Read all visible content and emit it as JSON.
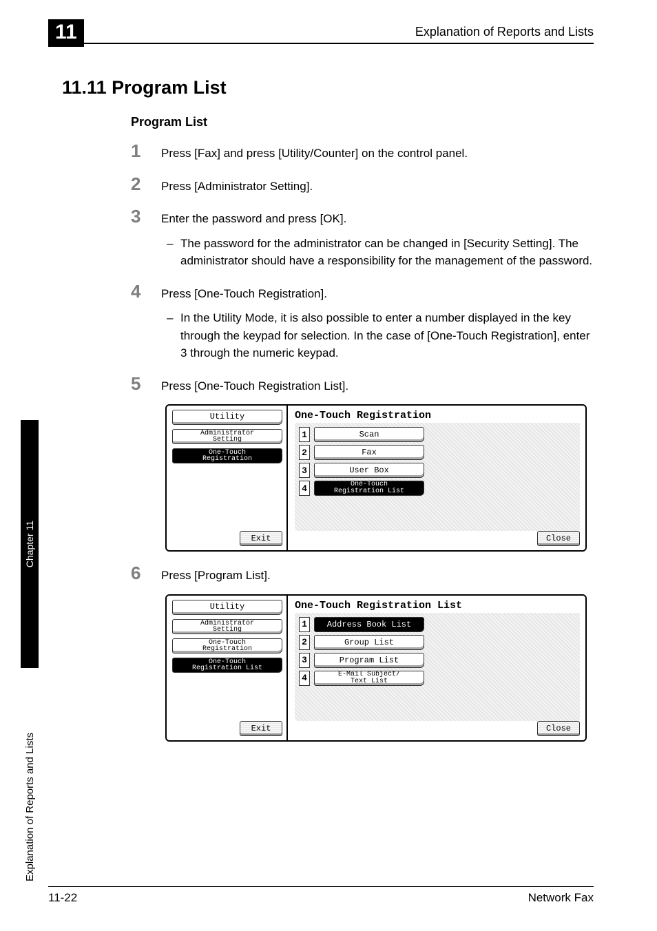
{
  "chapter_number": "11",
  "running_header": "Explanation of Reports and Lists",
  "section_title": "11.11 Program List",
  "sub_heading": "Program List",
  "steps": [
    {
      "num": "1",
      "text": "Press [Fax] and press [Utility/Counter] on the control panel."
    },
    {
      "num": "2",
      "text": "Press [Administrator Setting]."
    },
    {
      "num": "3",
      "text": "Enter the password and press [OK].",
      "subs": [
        "The password for the administrator can be changed in [Security Setting]. The administrator should have a responsibility for the management of the password."
      ]
    },
    {
      "num": "4",
      "text": "Press [One-Touch Registration].",
      "subs": [
        "In the Utility Mode, it is also possible to enter a number displayed in the key through the keypad for selection. In the case of [One-Touch Registration], enter 3 through the numeric keypad."
      ]
    },
    {
      "num": "5",
      "text": "Press [One-Touch Registration List]."
    },
    {
      "num": "6",
      "text": "Press [Program List]."
    }
  ],
  "screenshot1": {
    "left_items": [
      {
        "label": "Utility",
        "selected": false,
        "twoLine": false
      },
      {
        "label": "Administrator\nSetting",
        "selected": false,
        "twoLine": true
      },
      {
        "label": "One-Touch\nRegistration",
        "selected": true,
        "twoLine": true
      }
    ],
    "title": "One-Touch Registration",
    "rows": [
      {
        "n": "1",
        "label": "Scan",
        "selected": false
      },
      {
        "n": "2",
        "label": "Fax",
        "selected": false
      },
      {
        "n": "3",
        "label": "User Box",
        "selected": false
      },
      {
        "n": "4",
        "label": "One-Touch\nRegistration List",
        "selected": true
      }
    ],
    "exit": "Exit",
    "close": "Close"
  },
  "screenshot2": {
    "left_items": [
      {
        "label": "Utility",
        "selected": false,
        "twoLine": false
      },
      {
        "label": "Administrator\nSetting",
        "selected": false,
        "twoLine": true
      },
      {
        "label": "One-Touch\nRegistration",
        "selected": false,
        "twoLine": true
      },
      {
        "label": "One-Touch\nRegistration List",
        "selected": true,
        "twoLine": true
      }
    ],
    "title": "One-Touch Registration List",
    "rows": [
      {
        "n": "1",
        "label": "Address Book List",
        "selected": true
      },
      {
        "n": "2",
        "label": "Group List",
        "selected": false
      },
      {
        "n": "3",
        "label": "Program List",
        "selected": false
      },
      {
        "n": "4",
        "label": "E-Mail Subject/\nText List",
        "selected": false
      }
    ],
    "exit": "Exit",
    "close": "Close"
  },
  "side_tab": "Chapter 11",
  "side_label": "Explanation of Reports and Lists",
  "footer_left": "11-22",
  "footer_right": "Network Fax"
}
